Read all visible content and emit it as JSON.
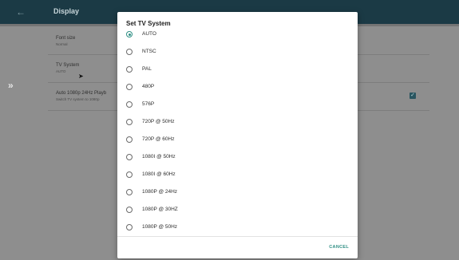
{
  "background": {
    "back_icon": "arrow-left-icon",
    "title": "Display",
    "items": [
      {
        "title": "Font size",
        "subtitle": "Normal"
      },
      {
        "title": "TV System",
        "subtitle": "AUTO"
      },
      {
        "title": "Auto 1080p 24Hz Playb",
        "subtitle": "Switch TV system to 1080p"
      }
    ],
    "chevron": "»",
    "check": "✓"
  },
  "dialog": {
    "title": "Set TV System",
    "selected": "AUTO",
    "options": [
      "AUTO",
      "NTSC",
      "PAL",
      "480P",
      "576P",
      "720P @ 50Hz",
      "720P @ 60Hz",
      "1080I @ 50Hz",
      "1080I @ 60Hz",
      "1080P @ 24Hz",
      "1080P @ 30HZ",
      "1080P @ 50Hz"
    ],
    "cancel_label": "CANCEL"
  },
  "colors": {
    "accent": "#2f8f84",
    "topbar": "#1b3a45",
    "scrim": "#8e8e8e"
  }
}
